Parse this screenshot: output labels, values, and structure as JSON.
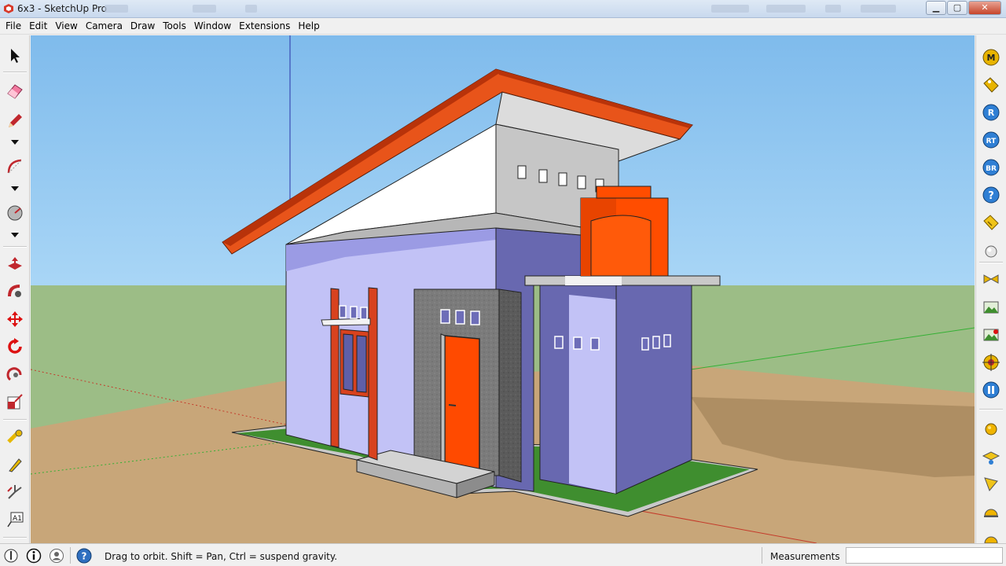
{
  "window": {
    "title": "6x3 - SketchUp Pro",
    "buttons": {
      "minimize": "▁",
      "maximize": "▢",
      "close": "✕"
    }
  },
  "menu": [
    "File",
    "Edit",
    "View",
    "Camera",
    "Draw",
    "Tools",
    "Window",
    "Extensions",
    "Help"
  ],
  "left_toolbar": [
    "select-icon",
    "eraser-icon",
    "pencil-icon",
    "arc-icon",
    "protractor-icon",
    "push-pull-icon",
    "follow-me-icon",
    "move-icon",
    "rotate-icon",
    "offset-icon",
    "scale-icon",
    "tape-measure-icon",
    "paint-bucket-icon",
    "axes-icon",
    "text-icon"
  ],
  "right_toolbar": [
    {
      "icon": "m-extension-icon",
      "label": "M"
    },
    {
      "icon": "tag-gold-icon",
      "label": ""
    },
    {
      "icon": "r-extension-icon",
      "label": "R"
    },
    {
      "icon": "rt-extension-icon",
      "label": "RT"
    },
    {
      "icon": "br-extension-icon",
      "label": "BR"
    },
    {
      "icon": "help-extension-icon",
      "label": "?"
    },
    {
      "icon": "tag-yellow-icon",
      "label": ""
    },
    {
      "icon": "sphere-icon",
      "label": ""
    },
    {
      "icon": "bowtie-icon",
      "label": ""
    },
    {
      "icon": "landscape-icon",
      "label": ""
    },
    {
      "icon": "landscape-red-icon",
      "label": ""
    },
    {
      "icon": "target-icon",
      "label": ""
    },
    {
      "icon": "pause-icon",
      "label": ""
    },
    {
      "icon": "gold-ball-icon",
      "label": ""
    },
    {
      "icon": "section-plane-icon",
      "label": ""
    },
    {
      "icon": "flag-icon",
      "label": ""
    },
    {
      "icon": "helmet-icon",
      "label": ""
    }
  ],
  "colors": {
    "sky": "#8dc4ee",
    "grass": "#9bbd85",
    "ground": "#c7a578",
    "wall_lavender": "#c0c0f6",
    "wall_shadow": "#6a6ab0",
    "roof_orange": "#e8541a",
    "tank_orange": "#ff4d00",
    "door": "#ff4500"
  },
  "status": {
    "hint": "Drag to orbit. Shift = Pan, Ctrl = suspend gravity.",
    "measurements_label": "Measurements",
    "measurements_value": ""
  }
}
